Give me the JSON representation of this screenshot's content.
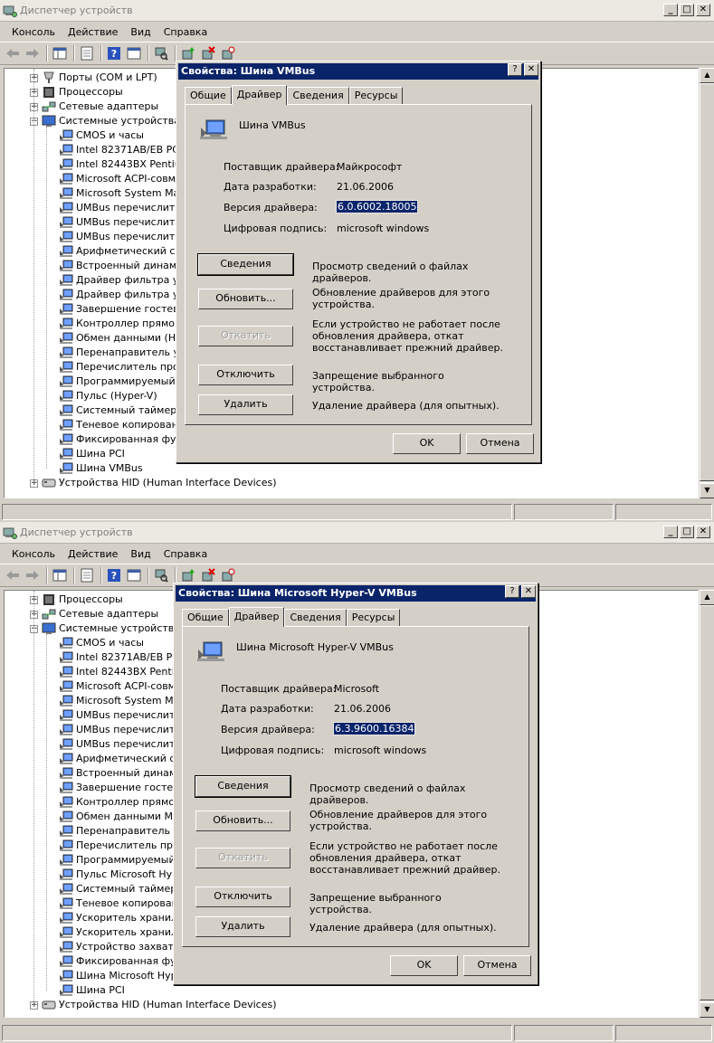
{
  "windows": [
    {
      "title": "Диспетчер устройств",
      "menu": [
        "Консоль",
        "Действие",
        "Вид",
        "Справка"
      ],
      "tree": [
        {
          "label": "Порты (COM и LPT)",
          "level": 0,
          "icon": "port-icon"
        },
        {
          "label": "Процессоры",
          "level": 0,
          "icon": "cpu-icon"
        },
        {
          "label": "Сетевые адаптеры",
          "level": 0,
          "icon": "network-icon"
        },
        {
          "label": "Системные устройства",
          "level": 0,
          "icon": "system-icon",
          "expanded": true
        },
        {
          "label": "CMOS и часы",
          "level": 1
        },
        {
          "label": "Intel 82371AB/EB PCI -",
          "level": 1
        },
        {
          "label": "Intel 82443BX Pentium",
          "level": 1
        },
        {
          "label": "Microsoft ACPI-совмес",
          "level": 1
        },
        {
          "label": "Microsoft System Mana",
          "level": 1
        },
        {
          "label": "UMBus перечислитель",
          "level": 1
        },
        {
          "label": "UMBus перечислитель",
          "level": 1
        },
        {
          "label": "UMBus перечислитель",
          "level": 1
        },
        {
          "label": "Арифметический сопр",
          "level": 1
        },
        {
          "label": "Встроенный динамик",
          "level": 1
        },
        {
          "label": "Драйвер фильтра уск",
          "level": 1
        },
        {
          "label": "Драйвер фильтра уск",
          "level": 1
        },
        {
          "label": "Завершение гостевой",
          "level": 1
        },
        {
          "label": "Контроллер прямого",
          "level": 1
        },
        {
          "label": "Обмен данными (Hype",
          "level": 1
        },
        {
          "label": "Перенаправитель уст",
          "level": 1
        },
        {
          "label": "Перечислитель прогр",
          "level": 1
        },
        {
          "label": "Программируемый ко",
          "level": 1
        },
        {
          "label": "Пульс (Hyper-V)",
          "level": 1
        },
        {
          "label": "Системный таймер",
          "level": 1
        },
        {
          "label": "Теневое копирование",
          "level": 1
        },
        {
          "label": "Фиксированная функ",
          "level": 1
        },
        {
          "label": "Шина PCI",
          "level": 1
        },
        {
          "label": "Шина VMBus",
          "level": 1
        },
        {
          "label": "Устройства HID (Human Interface Devices)",
          "level": 0,
          "icon": "hid-icon"
        }
      ],
      "dialog": {
        "title": "Свойства: Шина VMBus",
        "tabs": [
          "Общие",
          "Драйвер",
          "Сведения",
          "Ресурсы"
        ],
        "active_tab": 1,
        "device_name": "Шина VMBus",
        "fields": [
          {
            "label": "Поставщик драйвера:",
            "value": "Майкрософт"
          },
          {
            "label": "Дата разработки:",
            "value": "21.06.2006"
          },
          {
            "label": "Версия драйвера:",
            "value": "6.0.6002.18005",
            "selected": true
          },
          {
            "label": "Цифровая подпись:",
            "value": "microsoft windows"
          }
        ],
        "actions": [
          {
            "button": "Сведения",
            "desc": "Просмотр сведений о файлах драйверов.",
            "default": true
          },
          {
            "button": "Обновить...",
            "desc": "Обновление драйверов для этого устройства."
          },
          {
            "button": "Откатить",
            "desc": "Если устройство не работает после обновления драйвера, откат восстанавливает прежний драйвер.",
            "disabled": true
          },
          {
            "button": "Отключить",
            "desc": "Запрещение выбранного устройства."
          },
          {
            "button": "Удалить",
            "desc": "Удаление драйвера (для опытных)."
          }
        ],
        "ok": "OK",
        "cancel": "Отмена"
      }
    },
    {
      "title": "Диспетчер устройств",
      "menu": [
        "Консоль",
        "Действие",
        "Вид",
        "Справка"
      ],
      "tree": [
        {
          "label": "Процессоры",
          "level": 0,
          "icon": "cpu-icon"
        },
        {
          "label": "Сетевые адаптеры",
          "level": 0,
          "icon": "network-icon"
        },
        {
          "label": "Системные устройства",
          "level": 0,
          "icon": "system-icon",
          "expanded": true
        },
        {
          "label": "CMOS и часы",
          "level": 1
        },
        {
          "label": "Intel 82371AB/EB PCI -",
          "level": 1
        },
        {
          "label": "Intel 82443BX Pentium",
          "level": 1
        },
        {
          "label": "Microsoft ACPI-совмес",
          "level": 1
        },
        {
          "label": "Microsoft System Mana",
          "level": 1
        },
        {
          "label": "UMBus перечислитель",
          "level": 1
        },
        {
          "label": "UMBus перечислитель",
          "level": 1
        },
        {
          "label": "UMBus перечислитель",
          "level": 1
        },
        {
          "label": "Арифметический сопр",
          "level": 1
        },
        {
          "label": "Встроенный динамик",
          "level": 1
        },
        {
          "label": "Завершение гостевой",
          "level": 1
        },
        {
          "label": "Контроллер прямого",
          "level": 1
        },
        {
          "label": "Обмен данными Micro",
          "level": 1
        },
        {
          "label": "Перенаправитель уст",
          "level": 1
        },
        {
          "label": "Перечислитель прогр",
          "level": 1
        },
        {
          "label": "Программируемый ко",
          "level": 1
        },
        {
          "label": "Пульс Microsoft Hyper",
          "level": 1
        },
        {
          "label": "Системный таймер",
          "level": 1
        },
        {
          "label": "Теневое копирование",
          "level": 1
        },
        {
          "label": "Ускоритель хранили",
          "level": 1
        },
        {
          "label": "Ускоритель хранили",
          "level": 1
        },
        {
          "label": "Устройство захвата S",
          "level": 1
        },
        {
          "label": "Фиксированная функ",
          "level": 1
        },
        {
          "label": "Шина Microsoft Hyper-",
          "level": 1
        },
        {
          "label": "Шина PCI",
          "level": 1
        },
        {
          "label": "Устройства HID (Human Interface Devices)",
          "level": 0,
          "icon": "hid-icon"
        }
      ],
      "dialog": {
        "title": "Свойства: Шина Microsoft Hyper-V VMBus",
        "tabs": [
          "Общие",
          "Драйвер",
          "Сведения",
          "Ресурсы"
        ],
        "active_tab": 1,
        "device_name": "Шина Microsoft Hyper-V VMBus",
        "fields": [
          {
            "label": "Поставщик драйвера:",
            "value": "Microsoft"
          },
          {
            "label": "Дата разработки:",
            "value": "21.06.2006"
          },
          {
            "label": "Версия драйвера:",
            "value": "6.3.9600.16384",
            "selected": true
          },
          {
            "label": "Цифровая подпись:",
            "value": "microsoft windows"
          }
        ],
        "actions": [
          {
            "button": "Сведения",
            "desc": "Просмотр сведений о файлах драйверов.",
            "default": true
          },
          {
            "button": "Обновить...",
            "desc": "Обновление драйверов для этого устройства."
          },
          {
            "button": "Откатить",
            "desc": "Если устройство не работает после обновления драйвера, откат восстанавливает прежний драйвер.",
            "disabled": true
          },
          {
            "button": "Отключить",
            "desc": "Запрещение выбранного устройства."
          },
          {
            "button": "Удалить",
            "desc": "Удаление драйвера (для опытных)."
          }
        ],
        "ok": "OK",
        "cancel": "Отмена"
      }
    }
  ],
  "colors": {
    "dialog_title_bg": "#0a246a",
    "selection": "#0a246a",
    "face": "#d4d0c8"
  }
}
